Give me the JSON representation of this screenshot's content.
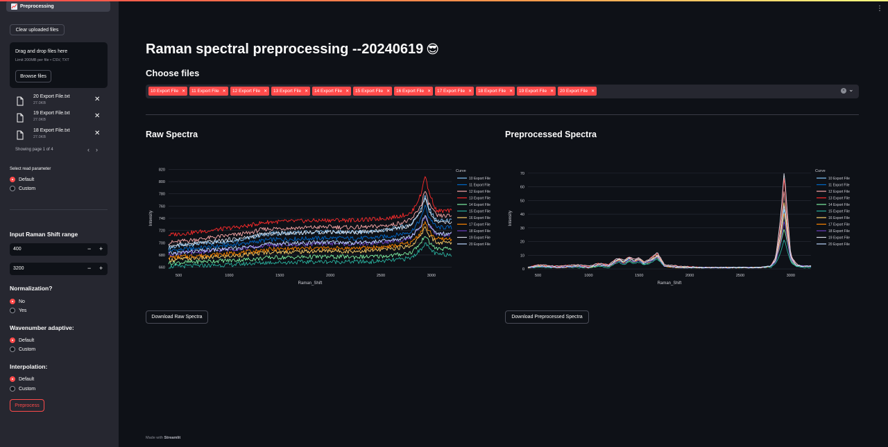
{
  "sidebar": {
    "nav_active": "Preprocessing",
    "clear_button": "Clear uploaded files",
    "uploader": {
      "title": "Drag and drop files here",
      "limit": "Limit 200MB per file • CSV, TXT",
      "browse": "Browse files"
    },
    "files": [
      {
        "name": "20 Export File.txt",
        "size": "27.0KB"
      },
      {
        "name": "19 Export File.txt",
        "size": "27.0KB"
      },
      {
        "name": "18 Export File.txt",
        "size": "27.0KB"
      }
    ],
    "pager": "Showing page 1 of 4",
    "read_param": {
      "label": "Select read parameter",
      "options": [
        "Default",
        "Custom"
      ],
      "selected": 0
    },
    "shift_range": {
      "label": "Input Raman Shift range",
      "min": "400",
      "max": "3200",
      "minus": "−",
      "plus": "+"
    },
    "normalization": {
      "label": "Normalization?",
      "options": [
        "No",
        "Yes"
      ],
      "selected": 0
    },
    "wavenumber": {
      "label": "Wavenumber adaptive:",
      "options": [
        "Default",
        "Custom"
      ],
      "selected": 0
    },
    "interpolation": {
      "label": "Interpolation:",
      "options": [
        "Default",
        "Custom"
      ],
      "selected": 0
    },
    "preprocess_button": "Preprocess"
  },
  "main": {
    "title": "Raman spectral preprocessing --20240619",
    "title_emoji": "😎",
    "choose_files": "Choose files",
    "selected_files": [
      "10 Export File",
      "11 Export File",
      "12 Export File",
      "13 Export File",
      "14 Export File",
      "15 Export File",
      "16 Export File",
      "17 Export File",
      "18 Export File",
      "19 Export File",
      "20 Export File"
    ],
    "raw_header": "Raw Spectra",
    "pre_header": "Preprocessed Spectra",
    "download_raw": "Download Raw Spectra",
    "download_pre": "Download Preprocessed Spectra",
    "footer_prefix": "Made with",
    "footer_brand": "Streamlit",
    "menu_icon": "⋮"
  },
  "colors": {
    "accent": "#ff4b4b",
    "background": "#0e1117",
    "sidebar": "#262730"
  },
  "chart_data": [
    {
      "type": "line",
      "title": "",
      "xlabel": "Raman_Shift",
      "ylabel": "Intensity",
      "xlim": [
        400,
        3200
      ],
      "ylim": [
        655,
        825
      ],
      "xticks": [
        500,
        1000,
        1500,
        2000,
        2500,
        3000
      ],
      "yticks": [
        660,
        680,
        700,
        720,
        740,
        760,
        780,
        800,
        820
      ],
      "legend_title": "Curve",
      "legend_position": "right",
      "grid": true,
      "x": [
        400,
        600,
        800,
        1000,
        1200,
        1300,
        1400,
        1600,
        1800,
        2000,
        2200,
        2400,
        2600,
        2800,
        2900,
        2935,
        2970,
        3050,
        3200
      ],
      "series": [
        {
          "name": "10 Export File",
          "color": "#83c9ff",
          "values": [
            692,
            697,
            700,
            703,
            708,
            712,
            715,
            716,
            717,
            718,
            717,
            718,
            722,
            730,
            755,
            778,
            758,
            736,
            736
          ]
        },
        {
          "name": "11 Export File",
          "color": "#0068c9",
          "values": [
            687,
            690,
            693,
            696,
            700,
            703,
            705,
            706,
            707,
            708,
            707,
            708,
            711,
            718,
            740,
            762,
            744,
            725,
            725
          ]
        },
        {
          "name": "12 Export File",
          "color": "#ffabab",
          "values": [
            700,
            704,
            708,
            712,
            716,
            721,
            723,
            724,
            725,
            726,
            725,
            726,
            729,
            737,
            762,
            786,
            766,
            744,
            744
          ]
        },
        {
          "name": "13 Export File",
          "color": "#ff2b2b",
          "values": [
            713,
            716,
            720,
            724,
            728,
            732,
            734,
            735,
            736,
            737,
            737,
            738,
            741,
            748,
            780,
            812,
            786,
            752,
            752
          ]
        },
        {
          "name": "14 Export File",
          "color": "#7defa1",
          "values": [
            667,
            668,
            670,
            671,
            673,
            674,
            676,
            676,
            677,
            677,
            677,
            677,
            679,
            684,
            700,
            714,
            702,
            690,
            690
          ]
        },
        {
          "name": "15 Export File",
          "color": "#29b09d",
          "values": [
            661,
            662,
            663,
            664,
            666,
            667,
            668,
            668,
            669,
            669,
            669,
            669,
            671,
            675,
            690,
            700,
            692,
            681,
            681
          ]
        },
        {
          "name": "16 Export File",
          "color": "#ffd16a",
          "values": [
            672,
            674,
            676,
            678,
            681,
            683,
            685,
            685,
            686,
            687,
            686,
            687,
            690,
            695,
            712,
            728,
            714,
            700,
            700
          ]
        },
        {
          "name": "17 Export File",
          "color": "#ff8700",
          "values": [
            676,
            678,
            680,
            682,
            685,
            687,
            689,
            690,
            691,
            691,
            691,
            692,
            694,
            700,
            718,
            735,
            720,
            706,
            706
          ]
        },
        {
          "name": "18 Export File",
          "color": "#6d3fc0",
          "values": [
            681,
            684,
            686,
            689,
            692,
            694,
            696,
            697,
            698,
            699,
            698,
            699,
            702,
            708,
            727,
            746,
            730,
            713,
            713
          ]
        },
        {
          "name": "19 Export File",
          "color": "#d5dae5",
          "values": [
            695,
            698,
            701,
            705,
            709,
            713,
            715,
            716,
            717,
            718,
            717,
            718,
            721,
            728,
            752,
            774,
            755,
            733,
            733
          ]
        },
        {
          "name": "20 Export File",
          "color": "#bdd8ff",
          "values": [
            682,
            685,
            688,
            690,
            693,
            696,
            698,
            699,
            700,
            701,
            700,
            701,
            704,
            710,
            728,
            746,
            731,
            715,
            715
          ]
        }
      ]
    },
    {
      "type": "line",
      "title": "",
      "xlabel": "Raman_Shift",
      "ylabel": "Intensity",
      "xlim": [
        400,
        3200
      ],
      "ylim": [
        -1,
        75
      ],
      "xticks": [
        500,
        1000,
        1500,
        2000,
        2500,
        3000
      ],
      "yticks": [
        0,
        10,
        20,
        30,
        40,
        50,
        60,
        70
      ],
      "legend_title": "Curve",
      "legend_position": "right",
      "grid": true,
      "x": [
        400,
        500,
        700,
        900,
        1000,
        1100,
        1200,
        1250,
        1300,
        1350,
        1400,
        1450,
        1500,
        1550,
        1600,
        1650,
        1680,
        1750,
        1900,
        2100,
        2300,
        2500,
        2700,
        2800,
        2850,
        2900,
        2935,
        2970,
        3000,
        3050,
        3100,
        3200
      ],
      "series": [
        {
          "name": "10 Export File",
          "color": "#83c9ff",
          "values": [
            1,
            2,
            1,
            2,
            1,
            3,
            2,
            5,
            7,
            5,
            8,
            6,
            7,
            4,
            6,
            8,
            10,
            2,
            1,
            1,
            1,
            1,
            1,
            2,
            6,
            24,
            45,
            24,
            8,
            3,
            2,
            2
          ]
        },
        {
          "name": "11 Export File",
          "color": "#0068c9",
          "values": [
            1,
            2,
            1,
            2,
            1,
            3,
            2,
            4,
            6,
            4,
            7,
            5,
            6,
            4,
            5,
            7,
            9,
            2,
            1,
            1,
            1,
            1,
            1,
            2,
            5,
            20,
            40,
            20,
            7,
            3,
            2,
            2
          ]
        },
        {
          "name": "12 Export File",
          "color": "#ffabab",
          "values": [
            1,
            2,
            1,
            2,
            1,
            3,
            2,
            5,
            7,
            5,
            8,
            6,
            8,
            4,
            6,
            9,
            11,
            2,
            1,
            1,
            1,
            1,
            1,
            2,
            7,
            30,
            58,
            30,
            9,
            3,
            2,
            2
          ]
        },
        {
          "name": "13 Export File",
          "color": "#ff2b2b",
          "values": [
            1,
            3,
            2,
            3,
            2,
            4,
            3,
            6,
            8,
            6,
            9,
            7,
            8,
            5,
            7,
            10,
            12,
            3,
            2,
            1,
            1,
            1,
            1,
            2,
            8,
            36,
            68,
            36,
            10,
            4,
            2,
            2
          ]
        },
        {
          "name": "14 Export File",
          "color": "#7defa1",
          "values": [
            1,
            2,
            1,
            2,
            1,
            2,
            2,
            4,
            6,
            4,
            6,
            5,
            6,
            3,
            5,
            7,
            8,
            2,
            1,
            1,
            1,
            1,
            1,
            2,
            5,
            18,
            30,
            18,
            6,
            2,
            2,
            2
          ]
        },
        {
          "name": "15 Export File",
          "color": "#29b09d",
          "values": [
            1,
            1,
            1,
            1,
            1,
            2,
            1,
            3,
            5,
            3,
            5,
            4,
            5,
            3,
            4,
            6,
            7,
            2,
            1,
            1,
            1,
            1,
            1,
            1,
            4,
            12,
            22,
            12,
            5,
            2,
            1,
            1
          ]
        },
        {
          "name": "16 Export File",
          "color": "#ffd16a",
          "values": [
            1,
            2,
            1,
            2,
            1,
            3,
            2,
            5,
            7,
            5,
            8,
            6,
            7,
            4,
            6,
            8,
            10,
            2,
            1,
            1,
            1,
            1,
            1,
            2,
            6,
            26,
            50,
            26,
            8,
            3,
            2,
            2
          ]
        },
        {
          "name": "17 Export File",
          "color": "#ff8700",
          "values": [
            1,
            2,
            1,
            2,
            1,
            3,
            2,
            4,
            6,
            4,
            7,
            5,
            7,
            4,
            5,
            8,
            9,
            2,
            1,
            1,
            1,
            1,
            1,
            2,
            6,
            22,
            42,
            22,
            7,
            3,
            2,
            2
          ]
        },
        {
          "name": "18 Export File",
          "color": "#6d3fc0",
          "values": [
            1,
            2,
            1,
            2,
            1,
            3,
            2,
            4,
            6,
            4,
            7,
            5,
            6,
            4,
            5,
            7,
            9,
            2,
            1,
            1,
            1,
            1,
            1,
            2,
            5,
            19,
            36,
            19,
            7,
            3,
            2,
            2
          ]
        },
        {
          "name": "19 Export File",
          "color": "#d5dae5",
          "values": [
            1,
            3,
            2,
            3,
            2,
            4,
            3,
            6,
            8,
            6,
            9,
            7,
            8,
            5,
            7,
            10,
            12,
            3,
            2,
            1,
            1,
            1,
            1,
            2,
            8,
            38,
            72,
            38,
            10,
            4,
            2,
            2
          ]
        },
        {
          "name": "20 Export File",
          "color": "#bdd8ff",
          "values": [
            1,
            2,
            1,
            2,
            1,
            3,
            2,
            5,
            7,
            5,
            8,
            6,
            7,
            4,
            6,
            8,
            10,
            2,
            1,
            1,
            1,
            1,
            1,
            2,
            6,
            25,
            48,
            25,
            8,
            3,
            2,
            2
          ]
        }
      ]
    }
  ]
}
